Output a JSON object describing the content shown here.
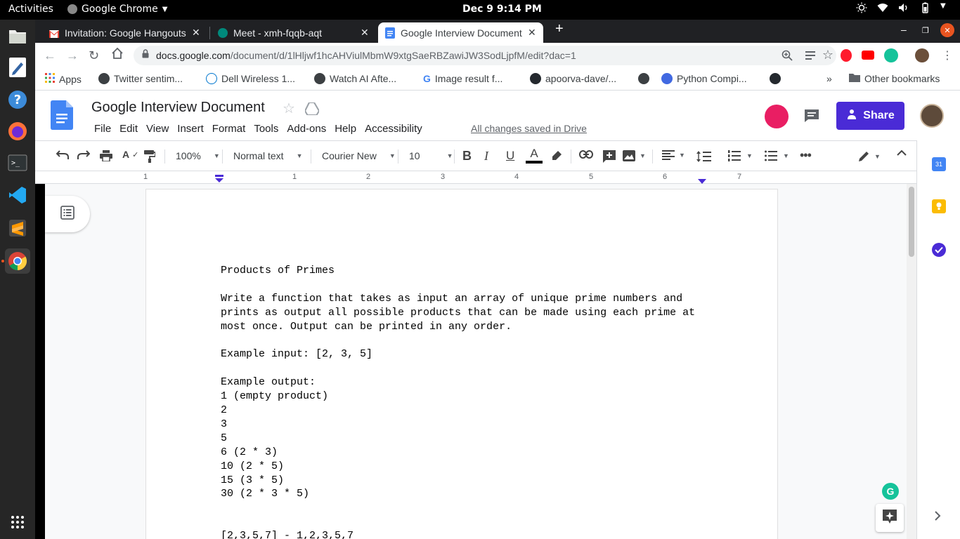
{
  "system": {
    "activities": "Activities",
    "app_name": "Google Chrome",
    "clock": "Dec 9   9:14 PM"
  },
  "dock": {
    "items": [
      "files-icon",
      "text-editor-icon",
      "help-icon",
      "firefox-icon",
      "terminal-icon",
      "vscode-icon",
      "sublime-icon",
      "chrome-icon",
      "show-apps-icon"
    ]
  },
  "tabs": [
    {
      "title": "Invitation: Google Hangouts"
    },
    {
      "title": "Meet - xmh-fqqb-aqt"
    },
    {
      "title": "Google Interview Document"
    }
  ],
  "address": {
    "host": "docs.google.com",
    "path": "/document/d/1lHljwf1hcAHViulMbmW9xtgSaeRBZawiJW3SodLjpfM/edit?dac=1"
  },
  "bookmarks": {
    "items": [
      "Apps",
      "Twitter sentim...",
      "Dell Wireless 1...",
      "Watch AI Afte...",
      "Image result f...",
      "apoorva-dave/...",
      "Python Compi..."
    ],
    "overflow": "»",
    "other": "Other bookmarks"
  },
  "doc": {
    "title": "Google Interview Document",
    "menu": [
      "File",
      "Edit",
      "View",
      "Insert",
      "Format",
      "Tools",
      "Add-ons",
      "Help",
      "Accessibility"
    ],
    "saved_status": "All changes saved in Drive",
    "share_label": "Share"
  },
  "format_toolbar": {
    "zoom": "100%",
    "style": "Normal text",
    "font": "Courier New",
    "size": "10"
  },
  "ruler": {
    "labels": [
      "1",
      "1",
      "2",
      "3",
      "4",
      "5",
      "6",
      "7"
    ]
  },
  "content": {
    "lines": [
      "Products of Primes",
      "",
      "Write a function that takes as input an array of unique prime numbers and",
      "prints as output all possible products that can be made using each prime at",
      "most once. Output can be printed in any order.",
      "",
      "Example input: [2, 3, 5]",
      "",
      "Example output:",
      "1 (empty product)",
      "2",
      "3",
      "5",
      "6 (2 * 3)",
      "10 (2 * 5)",
      "15 (3 * 5)",
      "30 (2 * 3 * 5)",
      "",
      "",
      "[2,3,5,7] - 1,2,3,5,7"
    ]
  },
  "side_panel": {
    "calendar_label": "31"
  },
  "colors": {
    "share": "#4a2bd6",
    "docs_blue": "#4285f4",
    "grammarly": "#15c39a"
  }
}
